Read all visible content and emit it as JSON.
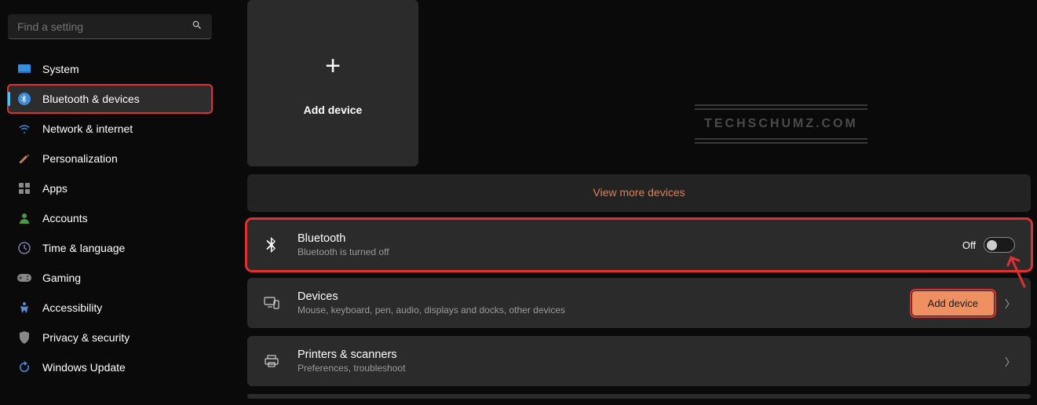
{
  "search": {
    "placeholder": "Find a setting"
  },
  "sidebar": {
    "items": [
      {
        "label": "System",
        "icon": "system-icon"
      },
      {
        "label": "Bluetooth & devices",
        "icon": "bluetooth-icon"
      },
      {
        "label": "Network & internet",
        "icon": "wifi-icon"
      },
      {
        "label": "Personalization",
        "icon": "personalization-icon"
      },
      {
        "label": "Apps",
        "icon": "apps-icon"
      },
      {
        "label": "Accounts",
        "icon": "accounts-icon"
      },
      {
        "label": "Time & language",
        "icon": "time-icon"
      },
      {
        "label": "Gaming",
        "icon": "gaming-icon"
      },
      {
        "label": "Accessibility",
        "icon": "accessibility-icon"
      },
      {
        "label": "Privacy & security",
        "icon": "privacy-icon"
      },
      {
        "label": "Windows Update",
        "icon": "update-icon"
      }
    ]
  },
  "main": {
    "add_device_card": "Add device",
    "view_more": "View more devices",
    "watermark": "TECHSCHUMZ.COM",
    "bluetooth_row": {
      "title": "Bluetooth",
      "desc": "Bluetooth is turned off",
      "toggle_label": "Off",
      "toggle_state": false
    },
    "devices_row": {
      "title": "Devices",
      "desc": "Mouse, keyboard, pen, audio, displays and docks, other devices",
      "button": "Add device"
    },
    "printers_row": {
      "title": "Printers & scanners",
      "desc": "Preferences, troubleshoot"
    }
  },
  "colors": {
    "accent": "#4cc2ff",
    "highlight": "#e03030",
    "button_bg": "#f09060",
    "link": "#e08050"
  }
}
